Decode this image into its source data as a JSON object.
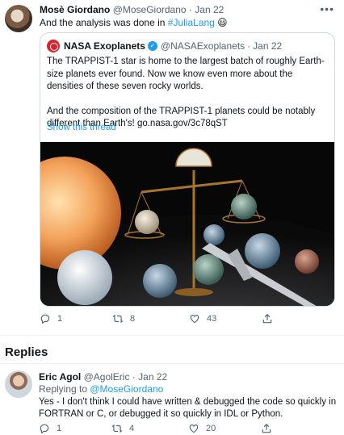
{
  "tweet": {
    "author_name": "Mosè Giordano",
    "author_handle": "@MoseGiordano",
    "separator": "·",
    "date": "Jan 22",
    "text_prefix": "And the analysis was done in ",
    "hashtag": "#JuliaLang",
    "emoji": "😃",
    "more_icon": "more-dots-icon"
  },
  "quote": {
    "author_name": "NASA Exoplanets",
    "author_handle": "@NASAExoplanets",
    "date": "Jan 22",
    "paragraph1": "The TRAPPIST-1 star is home to the largest batch of roughly Earth-size planets ever found. Now we know even more about the densities of these seven rocky worlds.",
    "paragraph2": "And the composition of the TRAPPIST-1 planets could be notably different than Earth's! go.nasa.gov/3c78qST",
    "show_thread": "Show this thread"
  },
  "actions": {
    "reply_count": "1",
    "retweet_count": "8",
    "like_count": "43"
  },
  "replies": {
    "title": "Replies"
  },
  "reply": {
    "author_name": "Eric Agol",
    "author_handle": "@AgolEric",
    "date": "Jan 22",
    "replying_label": "Replying to ",
    "replying_handle": "@MoseGiordano",
    "text": "Yes - I don't think I could have written & debugged the code so quickly in FORTRAN or C, or debugged it so quickly in IDL or Python.",
    "reply_count": "1",
    "retweet_count": "4",
    "like_count": "20"
  },
  "colors": {
    "accent": "#1d9bf0",
    "muted": "#536471",
    "border": "#cfd9de"
  }
}
